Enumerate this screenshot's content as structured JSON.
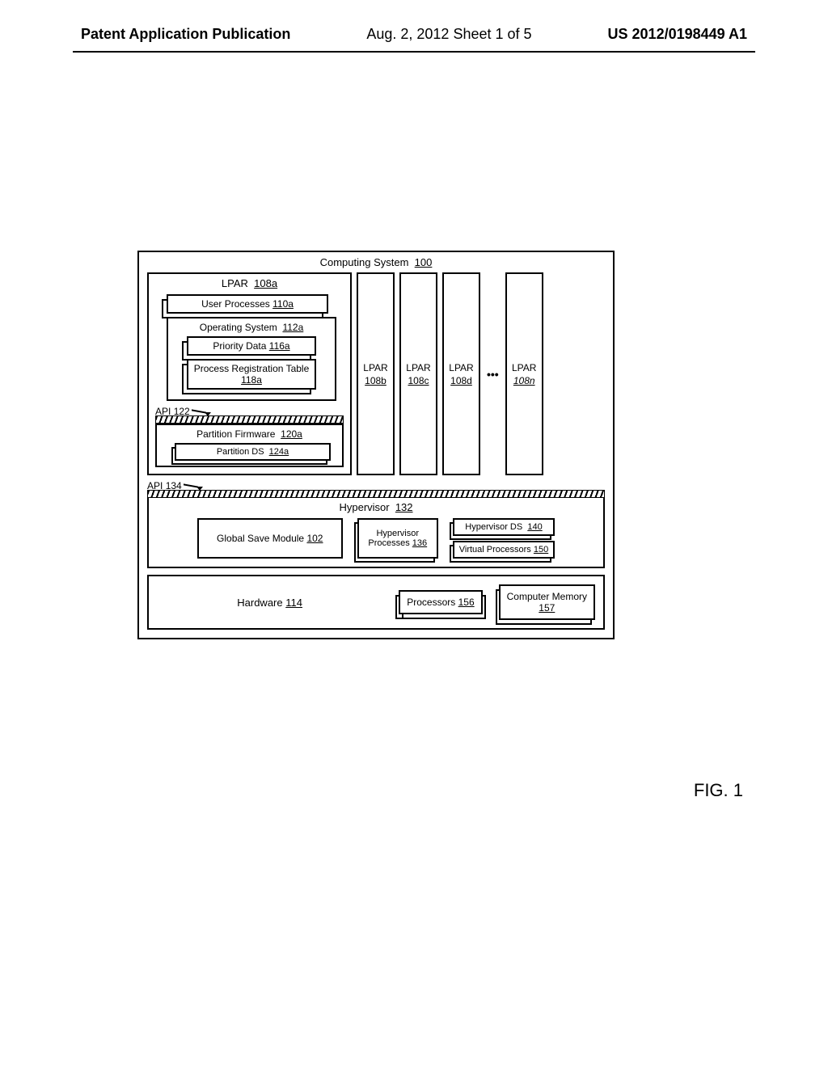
{
  "header": {
    "left": "Patent Application Publication",
    "mid": "Aug. 2, 2012  Sheet 1 of 5",
    "right": "US 2012/0198449 A1"
  },
  "system": {
    "title": "Computing System",
    "ref": "100"
  },
  "lpar_main": {
    "title": "LPAR",
    "ref": "108a",
    "user_processes": {
      "label": "User Processes",
      "ref": "110a"
    },
    "os": {
      "label": "Operating System",
      "ref": "112a"
    },
    "priority": {
      "label": "Priority Data",
      "ref": "116a"
    },
    "reg_table": {
      "label": "Process Registration Table",
      "ref": "118a"
    },
    "api": {
      "label": "API",
      "ref": "122"
    },
    "firmware": {
      "label": "Partition Firmware",
      "ref": "120a"
    },
    "pds": {
      "label": "Partition DS",
      "ref": "124a"
    }
  },
  "lpar_stubs": [
    {
      "t": "LPAR",
      "r": "108b"
    },
    {
      "t": "LPAR",
      "r": "108c"
    },
    {
      "t": "LPAR",
      "r": "108d"
    },
    {
      "t": "LPAR",
      "r": "108n",
      "italic": true
    }
  ],
  "api2": {
    "label": "API",
    "ref": "134"
  },
  "hv": {
    "title": "Hypervisor",
    "ref": "132",
    "gsm": "Global Save Module",
    "gsm_ref": "102",
    "proc": "Hypervisor Processes",
    "proc_ref": "136",
    "ds": "Hypervisor DS",
    "ds_ref": "140",
    "vp": "Virtual Processors",
    "vp_ref": "150"
  },
  "hw": {
    "label": "Hardware",
    "ref": "114",
    "proc": "Processors",
    "proc_ref": "156",
    "mem": "Computer Memory",
    "mem_ref": "157"
  },
  "fig": "FIG. 1"
}
